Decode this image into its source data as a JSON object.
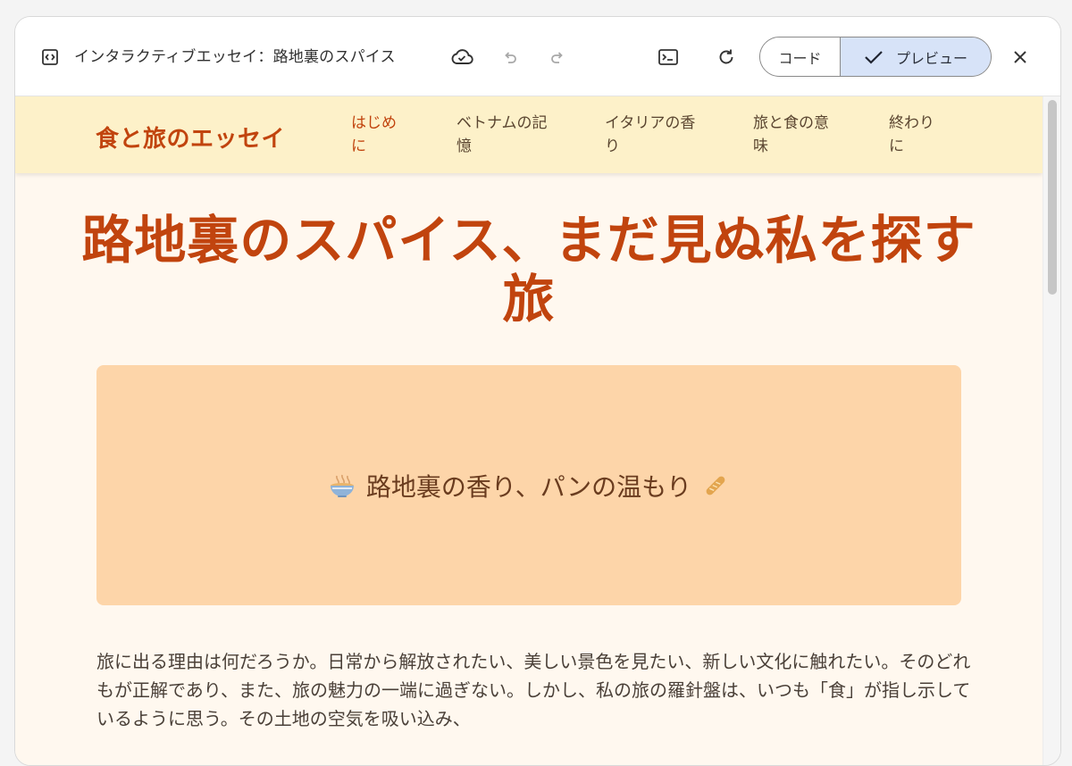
{
  "toolbar": {
    "title": "インタラクティブエッセイ：路地裏のスパイス",
    "code_label": "コード",
    "preview_label": "プレビュー",
    "icons": [
      "code-doc-icon",
      "cloud-sync-icon",
      "undo-icon",
      "redo-icon",
      "terminal-icon",
      "refresh-icon",
      "checkmark-icon",
      "close-icon"
    ]
  },
  "site": {
    "brand": "食と旅のエッセイ",
    "nav": [
      {
        "line1": "はじめ",
        "line2": "に",
        "active": true
      },
      {
        "line1": "ベトナムの記",
        "line2": "憶",
        "active": false
      },
      {
        "line1": "イタリアの香",
        "line2": "り",
        "active": false
      },
      {
        "line1": "旅と食の意",
        "line2": "味",
        "active": false
      },
      {
        "line1": "終わり",
        "line2": "に",
        "active": false
      }
    ],
    "hero_title": "路地裏のスパイス、まだ見ぬ私を探す旅",
    "banner_text": "路地裏の香り、パンの温もり",
    "banner_icons": [
      "noodle-bowl-icon",
      "baguette-icon"
    ],
    "paragraph": "旅に出る理由は何だろうか。日常から解放されたい、美しい景色を見たい、新しい文化に触れたい。そのどれもが正解であり、また、旅の魅力の一端に過ぎない。しかし、私の旅の羅針盤は、いつも「食」が指し示しているように思う。その土地の空気を吸い込み、"
  },
  "colors": {
    "accent": "#c1440e",
    "nav_bg": "#fdf1c9",
    "page_bg": "#fff8ef",
    "banner_bg": "#fdd5a9",
    "preview_toggle_bg": "#d7e3f8"
  }
}
